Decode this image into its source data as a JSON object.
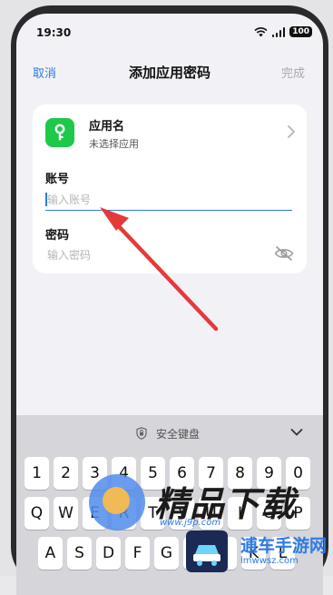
{
  "status_bar": {
    "time": "19:30",
    "battery": "100"
  },
  "nav": {
    "cancel": "取消",
    "title": "添加应用密码",
    "done": "完成"
  },
  "app_row": {
    "name": "应用名",
    "subtitle": "未选择应用"
  },
  "account": {
    "label": "账号",
    "placeholder": "输入账号",
    "value": ""
  },
  "password": {
    "label": "密码",
    "placeholder": "输入密码",
    "value": ""
  },
  "keyboard": {
    "title": "安全键盘",
    "row1": [
      "1",
      "2",
      "3",
      "4",
      "5",
      "6",
      "7",
      "8",
      "9",
      "0"
    ],
    "row2": [
      "Q",
      "W",
      "E",
      "R",
      "T",
      "Y",
      "U",
      "I",
      "O",
      "P"
    ],
    "row3": [
      "A",
      "S",
      "D",
      "F",
      "G",
      "H",
      "J",
      "K",
      "L"
    ]
  },
  "watermarks": {
    "brand1_text": "精品下载",
    "brand1_url": "www.j9p.com",
    "brand2_text": "逋车手游网",
    "brand2_url": "lmwwsz.com"
  },
  "colors": {
    "accent": "#2f7be5",
    "app_icon": "#1ec94a",
    "arrow": "#e53a3a"
  }
}
